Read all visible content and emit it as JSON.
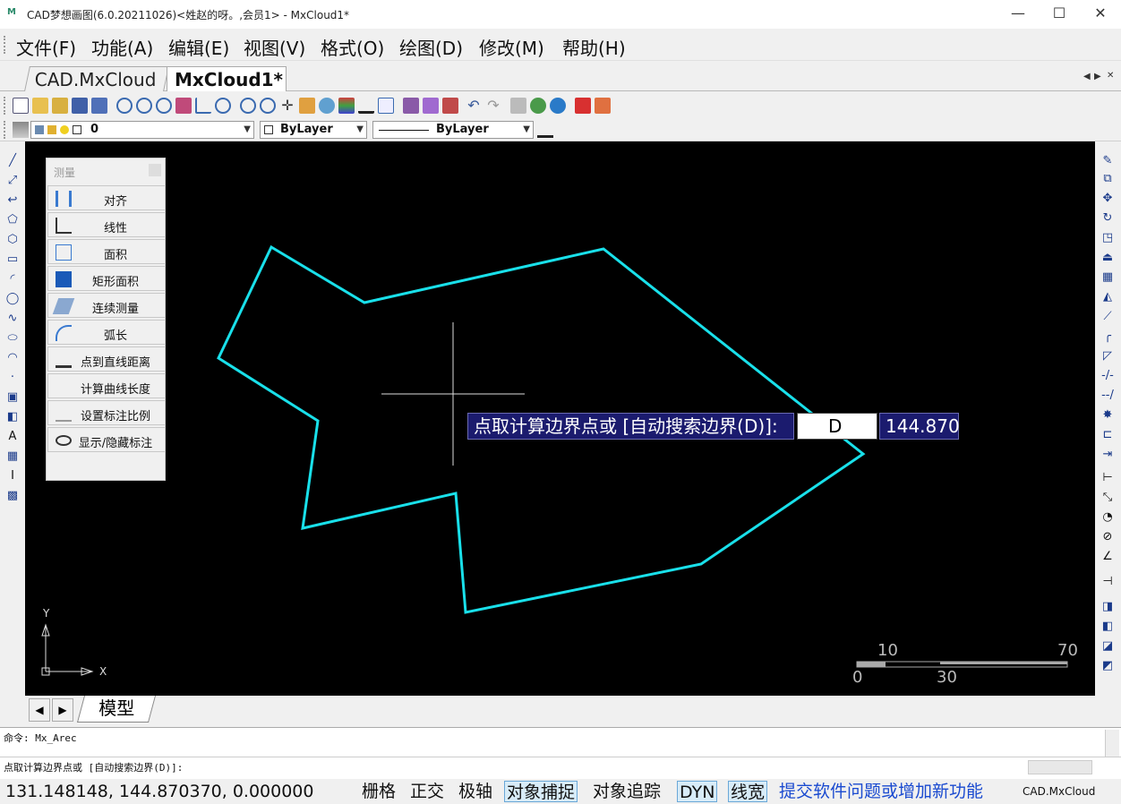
{
  "window": {
    "title": "CAD梦想画图(6.0.20211026)<姓赵的呀。,会员1> - MxCloud1*",
    "app_icon": "M",
    "min": "—",
    "max": "☐",
    "close": "✕"
  },
  "menu": [
    "文件(F)",
    "功能(A)",
    "编辑(E)",
    "视图(V)",
    "格式(O)",
    "绘图(D)",
    "修改(M)",
    "帮助(H)"
  ],
  "tabs": {
    "tab1": "CAD.MxCloud",
    "tab2": "MxCloud1*",
    "nav_left": "◀",
    "nav_right": "▶",
    "nav_close": "✕"
  },
  "props": {
    "layer": "0",
    "color": "ByLayer",
    "linetype": "ByLayer"
  },
  "panel": {
    "title": "测量",
    "items": [
      "对齐",
      "线性",
      "面积",
      "矩形面积",
      "连续测量",
      "弧长",
      "点到直线距离",
      "计算曲线长度",
      "设置标注比例",
      "显示/隐藏标注"
    ]
  },
  "dynamic": {
    "prompt": "点取计算边界点或 [自动搜索边界(D)]:",
    "input": "D",
    "value": "144.870"
  },
  "ucs": {
    "y": "Y",
    "x": "X"
  },
  "scale": {
    "top_left": "10",
    "top_right": "70",
    "bottom_left": "0",
    "bottom_mid": "30"
  },
  "bottom": {
    "model_tab": "模型"
  },
  "command": {
    "line1": "命令: Mx_Arec",
    "line2": "点取计算边界点或 [自动搜索边界(D)]:"
  },
  "status": {
    "coords": "131.148148,  144.870370,  0.000000",
    "grid": "栅格",
    "ortho": "正交",
    "polar": "极轴",
    "osnap": "对象捕捉",
    "otrack": "对象追踪",
    "dyn": "DYN",
    "lw": "线宽",
    "feedback": "提交软件问题或增加新功能",
    "brand": "CAD.MxCloud"
  },
  "colors": {
    "shape": "#19e0ea",
    "canvas": "#000000",
    "prompt_bg": "#1b1b6e"
  }
}
